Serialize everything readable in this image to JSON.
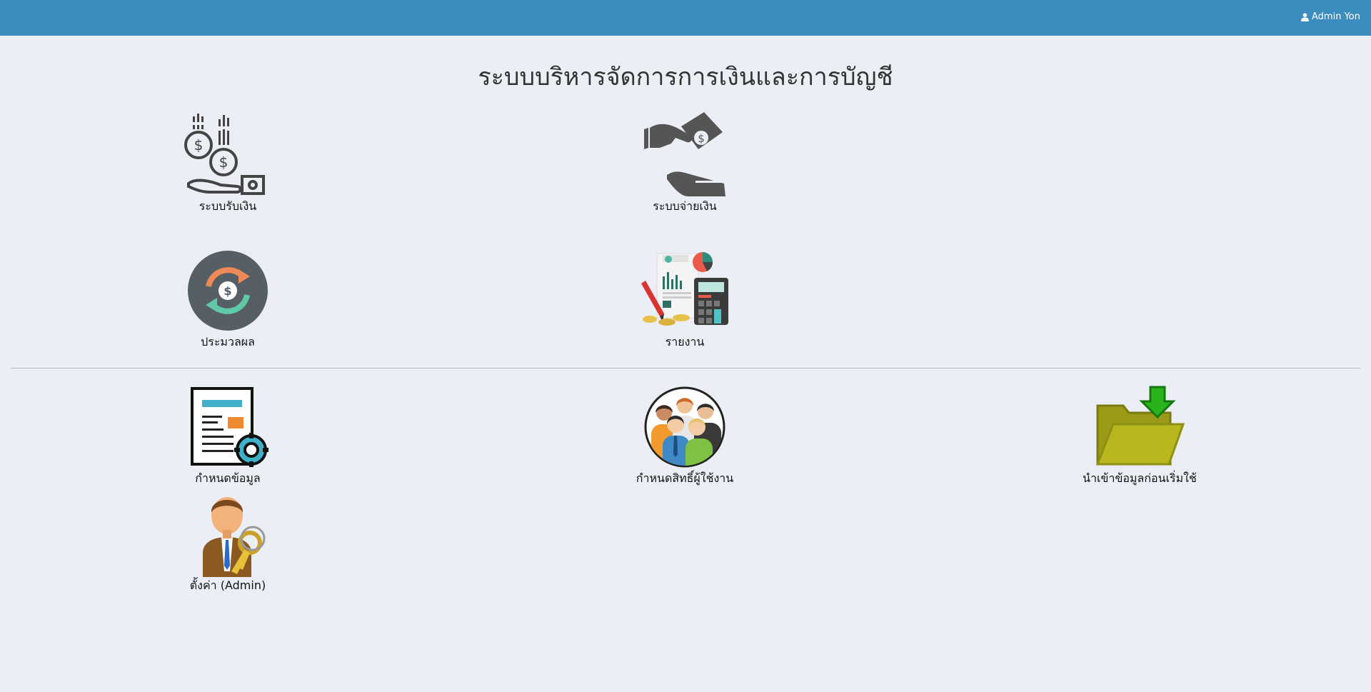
{
  "header": {
    "user_icon": "user-icon",
    "user_name": "Admin Yon",
    "bar_color": "#3a8dbe"
  },
  "page": {
    "title": "ระบบบริหารจัดการการเงินและการบัญชี"
  },
  "menu": {
    "receive": {
      "label": "ระบบรับเงิน",
      "icon": "receive-money-icon"
    },
    "pay": {
      "label": "ระบบจ่ายเงิน",
      "icon": "pay-money-icon"
    },
    "process": {
      "label": "ประมวลผล",
      "icon": "process-refresh-icon"
    },
    "report": {
      "label": "รายงาน",
      "icon": "report-calculator-icon"
    },
    "settings_data": {
      "label": "กำหนดข้อมูล",
      "icon": "document-gear-icon"
    },
    "permissions": {
      "label": "กำหนดสิทธิ์ผู้ใช้งาน",
      "icon": "user-group-icon"
    },
    "import": {
      "label": "นำเข้าข้อมูลก่อนเริ่มใช้",
      "icon": "folder-download-icon"
    },
    "admin": {
      "label": "ตั้งค่า (Admin)",
      "icon": "admin-key-icon"
    }
  }
}
